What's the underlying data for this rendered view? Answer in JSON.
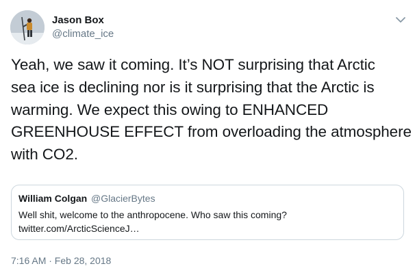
{
  "author": {
    "display_name": "Jason Box",
    "handle": "@climate_ice",
    "avatar_icon": "person-on-ice-avatar"
  },
  "tweet": {
    "text_lines": [
      "Yeah, we saw it coming. It’s NOT surprising that Arctic",
      "sea ice is declining nor is it surprising that the Arctic is",
      "warming. We expect this owing to ENHANCED",
      "GREENHOUSE EFFECT from overloading the atmosphere",
      "with CO2."
    ],
    "timestamp": "7:16 AM · Feb 28, 2018"
  },
  "quoted_tweet": {
    "display_name": "William Colgan",
    "handle": "@GlacierBytes",
    "text_lines": [
      "Well shit, welcome to the anthropocene. Who saw this coming?",
      "twitter.com/ArcticScienceJ…"
    ]
  },
  "icons": {
    "menu": "chevron-down-icon"
  },
  "colors": {
    "text": "#14171a",
    "secondary_text": "#657786",
    "border": "#ccd6dd"
  }
}
